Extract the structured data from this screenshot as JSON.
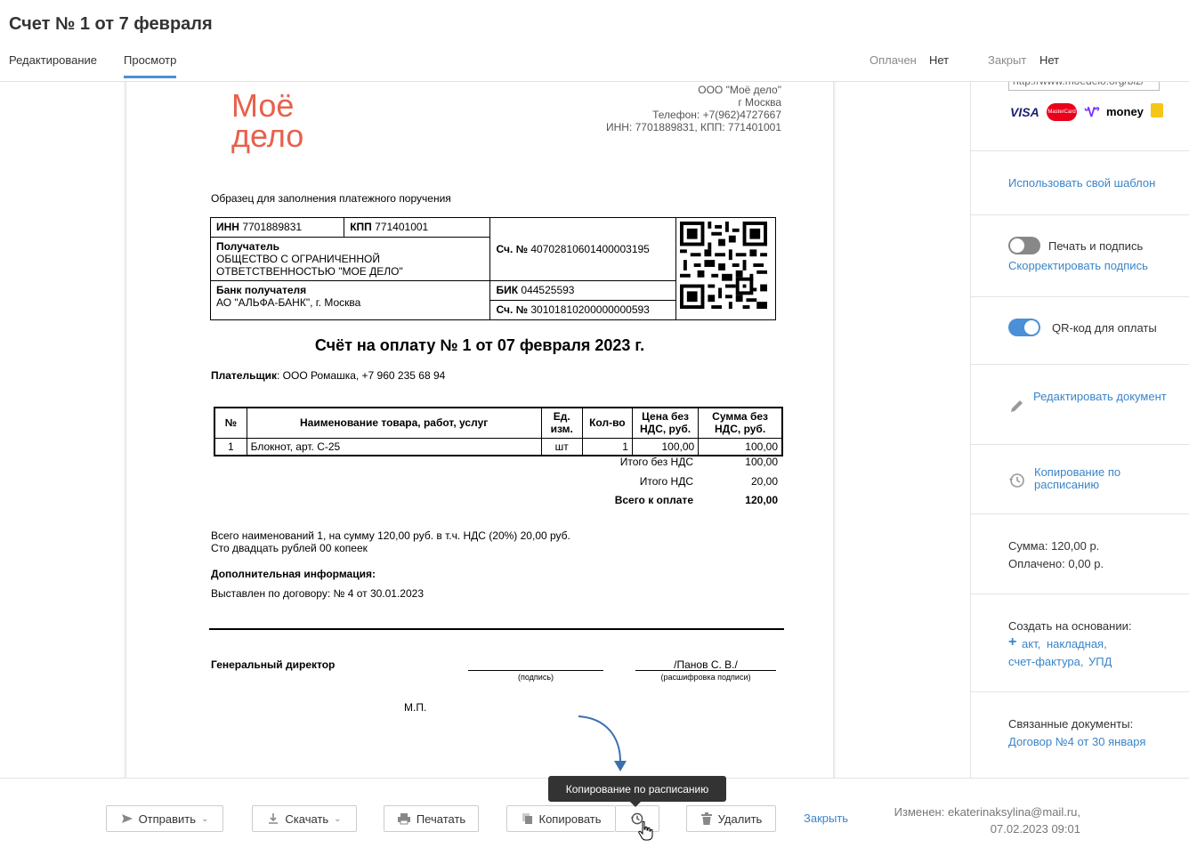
{
  "header": {
    "title": "Счет № 1 от 7 февраля",
    "tabs": [
      {
        "label": "Редактирование"
      },
      {
        "label": "Просмотр"
      }
    ],
    "paid_label": "Оплачен",
    "paid_value": "Нет",
    "closed_label": "Закрыт",
    "closed_value": "Нет"
  },
  "document": {
    "logo_line1": "Моё",
    "logo_line2": "дело",
    "company_lines": [
      "ООО \"Моё дело\"",
      "г Москва",
      "Телефон: +7(962)4727667",
      "ИНН: 7701889831, КПП: 771401001"
    ],
    "payment_sample_title": "Образец для заполнения платежного поручения",
    "bank": {
      "inn_label": "ИНН",
      "inn_value": "7701889831",
      "kpp_label": "КПП",
      "kpp_value": "771401001",
      "recipient_label": "Получатель",
      "recipient_value": "ОБЩЕСТВО С ОГРАНИЧЕННОЙ ОТВЕТСТВЕННОСТЬЮ \"МОЕ ДЕЛО\"",
      "account_label": "Сч. №",
      "account_value": "40702810601400003195",
      "bank_label": "Банк получателя",
      "bank_value": "АО \"АЛЬФА-БАНК\", г. Москва",
      "bik_label": "БИК",
      "bik_value": "044525593",
      "corr_label": "Сч. №",
      "corr_value": "30101810200000000593"
    },
    "invoice_title": "Счёт на оплату № 1 от 07 февраля 2023 г.",
    "payer_label": "Плательщик",
    "payer_value": ": ООО Ромашка, +7 960 235 68 94",
    "table": {
      "headers": [
        "№",
        "Наименование товара, работ, услуг",
        "Ед. изм.",
        "Кол-во",
        "Цена без НДС, руб.",
        "Сумма без НДС, руб."
      ],
      "rows": [
        [
          "1",
          "Блокнот, арт. С-25",
          "шт",
          "1",
          "100,00",
          "100,00"
        ]
      ]
    },
    "totals": [
      {
        "label": "Итого без НДС",
        "value": "100,00"
      },
      {
        "label": "Итого НДС",
        "value": "20,00"
      },
      {
        "label": "Всего к оплате",
        "value": "120,00"
      }
    ],
    "summary_line1": "Всего наименований 1, на сумму 120,00 руб. в т.ч. НДС (20%) 20,00 руб.",
    "summary_line2": "Сто двадцать рублей 00 копеек",
    "extra_title": "Дополнительная информация:",
    "extra_value": "Выставлен по договору: № 4 от 30.01.2023",
    "director_label": "Генеральный директор",
    "sign_caption": "(подпись)",
    "decipher_value": "/Панов С. В./",
    "decipher_caption": "(расшифровка подписи)",
    "stamp": "М.П."
  },
  "sidebar": {
    "url_value": "http://www.moedelo.org/biz/",
    "payment_logos": [
      "VISA",
      "MasterCard",
      "money"
    ],
    "use_template": "Использовать свой шаблон",
    "print_sign_label": "Печать и подпись",
    "print_sign_on": false,
    "correct_sign": "Скорректировать подпись",
    "qr_label": "QR-код для оплаты",
    "qr_on": true,
    "edit_doc": "Редактировать документ",
    "schedule_copy": "Копирование по расписанию",
    "sum_text": "Сумма: 120,00 р.",
    "paid_text": "Оплачено: 0,00 р.",
    "create_label": "Создать на основании:",
    "create_links": [
      "акт,",
      "накладная,",
      "счет-фактура,",
      "УПД"
    ],
    "related_label": "Связанные документы:",
    "related_link": "Договор №4 от 30 января",
    "colors": {
      "accent": "#3a85c8",
      "toggle_on": "#4a90d6",
      "toggle_off": "#888888"
    }
  },
  "footer": {
    "send": "Отправить",
    "download": "Скачать",
    "print": "Печатать",
    "copy": "Копировать",
    "delete": "Удалить",
    "close": "Закрыть",
    "modified_line1": "Изменен: ekaterinaksylina@mail.ru,",
    "modified_line2": "07.02.2023 09:01",
    "tooltip": "Копирование по расписанию"
  }
}
